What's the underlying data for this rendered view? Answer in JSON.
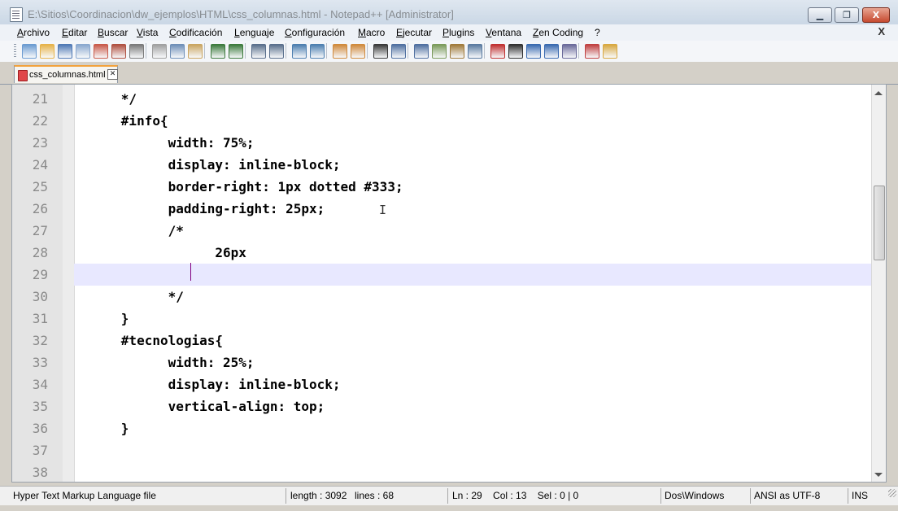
{
  "window": {
    "title": "E:\\Sitios\\Coordinacion\\dw_ejemplos\\HTML\\css_columnas.html - Notepad++ [Administrator]",
    "buttons": {
      "min": "▁",
      "max": "❐",
      "close": "X"
    }
  },
  "menu": {
    "items": [
      "Archivo",
      "Editar",
      "Buscar",
      "Vista",
      "Codificación",
      "Lenguaje",
      "Configuración",
      "Macro",
      "Ejecutar",
      "Plugins",
      "Ventana",
      "Zen Coding",
      "?"
    ],
    "close_label": "X"
  },
  "toolbar": {
    "icons": [
      "new-file-icon",
      "open-file-icon",
      "save-icon",
      "save-all-icon",
      "close-icon",
      "close-all-icon",
      "print-icon",
      "cut-icon",
      "copy-icon",
      "paste-icon",
      "undo-icon",
      "redo-icon",
      "find-icon",
      "replace-icon",
      "zoom-in-icon",
      "zoom-out-icon",
      "sync-v-icon",
      "sync-h-icon",
      "wrap-icon",
      "show-all-chars-icon",
      "indent-guide-icon",
      "udl-icon",
      "doc-map-icon",
      "function-list-icon",
      "record-macro-icon",
      "stop-macro-icon",
      "play-macro-icon",
      "run-macro-multiple-icon",
      "save-macro-icon",
      "spell-check-icon",
      "folder-icon"
    ]
  },
  "tab": {
    "label": "css_columnas.html",
    "close": "✕"
  },
  "editor": {
    "line_numbers": [
      "21",
      "22",
      "23",
      "24",
      "25",
      "26",
      "27",
      "28",
      "29",
      "30",
      "31",
      "32",
      "33",
      "34",
      "35",
      "36",
      "37",
      "38"
    ],
    "lines": [
      "\t*/",
      "\t#info{",
      "\t\twidth: 75%;",
      "\t\tdisplay: inline-block;",
      "\t\tborder-right: 1px dotted #333;",
      "\t\tpadding-right: 25px;",
      "\t\t/*",
      "\t\t\t26px",
      "\t\t\t",
      "\t\t*/",
      "\t}",
      "\t#tecnologias{",
      "\t\twidth: 25%;",
      "\t\tdisplay: inline-block;",
      "\t\tvertical-align: top;",
      "\t}",
      "",
      ""
    ],
    "current_line_index": 8,
    "cursor_glyph": "I"
  },
  "status": {
    "file_type": "Hyper Text Markup Language file",
    "length": "length : 3092",
    "lines": "lines : 68",
    "position": "Ln : 29    Col : 13    Sel : 0 | 0",
    "eol": "Dos\\Windows",
    "encoding": "ANSI as UTF-8",
    "mode": "INS"
  },
  "colors": {
    "current_line": "#e8e8ff",
    "caret": "#800080",
    "tab_accent": "#f2a23c"
  }
}
